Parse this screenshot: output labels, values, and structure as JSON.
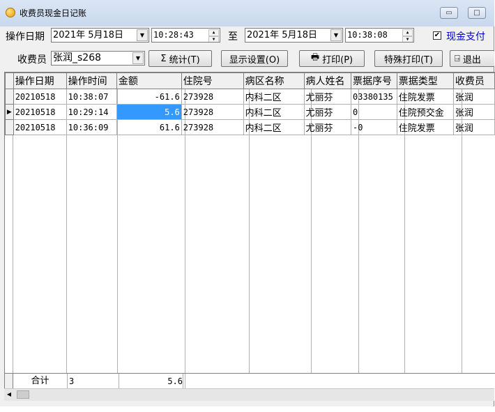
{
  "window": {
    "title": "收费员现金日记账",
    "min_glyph": "▭",
    "max_glyph": "□"
  },
  "filter": {
    "date_label": "操作日期",
    "start_date": "2021年 5月18日",
    "start_time": "10:28:43",
    "to_label": "至",
    "end_date": "2021年 5月18日",
    "end_time": "10:38:08",
    "cash_checkbox_label": "现金支付",
    "cash_checked": "✔",
    "cashier_label": "收费员",
    "cashier_value": "张润_s268"
  },
  "toolbar": {
    "stats": "统计(T)",
    "display_settings": "显示设置(O)",
    "print": "打印(P)",
    "special_print": "特殊打印(T)",
    "exit": "退出"
  },
  "table": {
    "columns": [
      "操作日期",
      "操作时间",
      "金额",
      "住院号",
      "病区名称",
      "病人姓名",
      "票据序号",
      "票据类型",
      "收费员"
    ],
    "rows": [
      [
        "20210518",
        "10:38:07",
        "-61.6",
        "273928",
        "内科二区",
        "尤丽芬",
        "03380135",
        "住院发票",
        "张润"
      ],
      [
        "20210518",
        "10:29:14",
        "5.6",
        "273928",
        "内科二区",
        "尤丽芬",
        "0",
        "住院预交金",
        "张润"
      ],
      [
        "20210518",
        "10:36:09",
        "61.6",
        "273928",
        "内科二区",
        "尤丽芬",
        "-0",
        "住院发票",
        "张润"
      ]
    ],
    "footer": {
      "label": "合计",
      "count": "3",
      "total": "5.6"
    }
  }
}
